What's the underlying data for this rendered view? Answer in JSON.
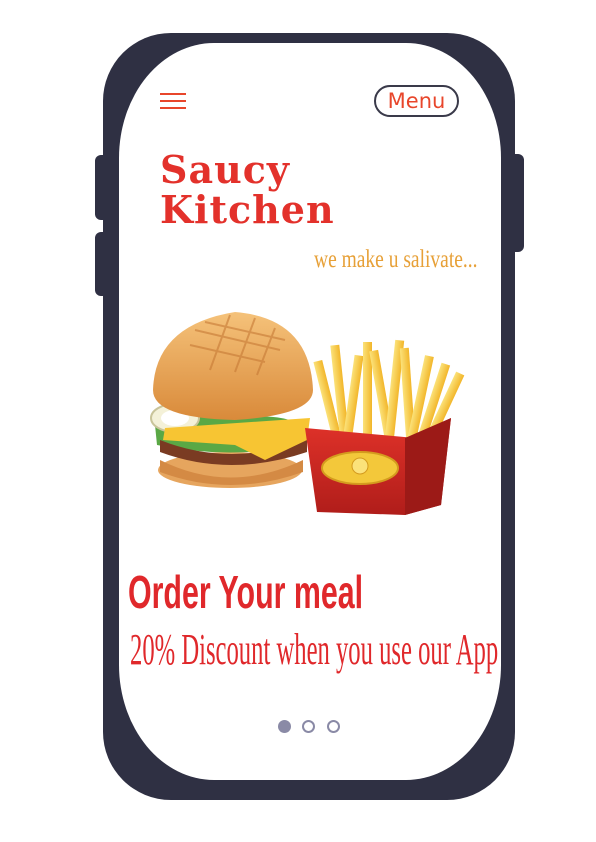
{
  "header": {
    "menu_icon": "hamburger-icon",
    "menu_label": "Menu"
  },
  "brand": {
    "line1": "Saucy",
    "line2": "Kitchen",
    "tagline": "we make u salivate...",
    "color": "#e3312b",
    "tagline_color": "#e7a037"
  },
  "hero": {
    "image": "burger-and-fries"
  },
  "promo": {
    "headline": "Order Your meal",
    "subline": "20% Discount when you use our App",
    "color": "#e0282b"
  },
  "carousel": {
    "total": 3,
    "active_index": 0
  },
  "colors": {
    "device": "#2f3043",
    "accent": "#e8462b",
    "dot": "#8a8aa6"
  }
}
